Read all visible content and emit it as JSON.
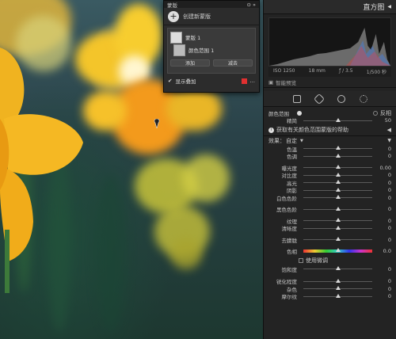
{
  "histogram": {
    "title": "直方图",
    "iso": "ISO 1250",
    "focal": "18 mm",
    "aperture": "ƒ / 3.5",
    "shutter": "1/500 秒",
    "smart_preview": "智能预览"
  },
  "masks_panel": {
    "title": "蒙版",
    "create_label": "创建新蒙版",
    "mask_name": "蒙版 1",
    "component_name": "颜色范围 1",
    "add_label": "添加",
    "subtract_label": "减去",
    "overlay_label": "显示叠加",
    "overlay_color": "#e03030"
  },
  "color_range": {
    "label": "颜色范围",
    "invert_label": "反相",
    "refine_label": "精简",
    "refine_value": "50",
    "refine_level": 50,
    "help_text": "获取有关颜色范围蒙版的帮助"
  },
  "effect": {
    "label": "效果：",
    "preset": "自定"
  },
  "sliders": [
    {
      "label": "色温",
      "value": "0",
      "level": 50
    },
    {
      "label": "色调",
      "value": "0",
      "level": 50
    },
    {
      "label": "曝光度",
      "value": "0.00",
      "level": 50
    },
    {
      "label": "对比度",
      "value": "0",
      "level": 50
    },
    {
      "label": "高光",
      "value": "0",
      "level": 50
    },
    {
      "label": "阴影",
      "value": "0",
      "level": 50
    },
    {
      "label": "白色色阶",
      "value": "0",
      "level": 50
    },
    {
      "label": "黑色色阶",
      "value": "0",
      "level": 50
    },
    {
      "label": "纹理",
      "value": "0",
      "level": 50
    },
    {
      "label": "清晰度",
      "value": "0",
      "level": 50
    },
    {
      "label": "去朦胧",
      "value": "0",
      "level": 50
    }
  ],
  "hue": {
    "label": "色相",
    "value": "0.0",
    "level": 50,
    "fine_label": "使用微调"
  },
  "saturation": {
    "label": "饱和度",
    "value": "0",
    "level": 50
  },
  "sliders2": [
    {
      "label": "锐化程度",
      "value": "0",
      "level": 50
    },
    {
      "label": "杂色",
      "value": "0",
      "level": 50
    },
    {
      "label": "摩尔纹",
      "value": "0",
      "level": 50
    }
  ]
}
